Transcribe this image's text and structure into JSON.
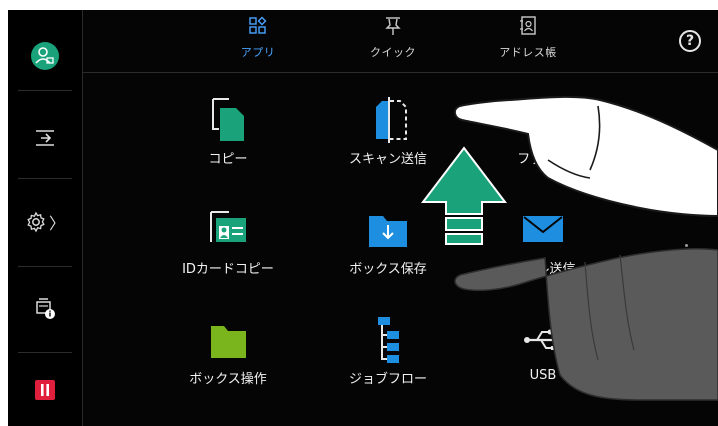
{
  "colors": {
    "accent": "#1aa37a",
    "screen_bg": "#050505",
    "pause_red": "#e01f3c",
    "tab_active": "#4aa3ff"
  },
  "sidebar": {
    "user_icon": "user-login-icon",
    "items": [
      {
        "icon": "job-in-icon"
      },
      {
        "icon": "settings-gear-icon",
        "chevron": "〉"
      },
      {
        "icon": "device-info-icon"
      },
      {
        "icon": "pause-icon"
      }
    ]
  },
  "tabs": [
    {
      "label": "アプリ",
      "icon": "apps-grid-icon",
      "active": true
    },
    {
      "label": "クイック",
      "icon": "quick-pin-icon",
      "active": false
    },
    {
      "label": "アドレス帳",
      "icon": "address-book-icon",
      "active": false
    }
  ],
  "help_icon": "?",
  "apps": [
    {
      "label": "コピー",
      "icon": "copy-icon"
    },
    {
      "label": "スキャン送信",
      "icon": "scan-send-icon"
    },
    {
      "label": "ファクス",
      "icon": "fax-icon"
    },
    {
      "label": "IDカードコピー",
      "icon": "id-card-copy-icon"
    },
    {
      "label": "ボックス保存",
      "icon": "box-save-icon"
    },
    {
      "label": "メール送信",
      "icon": "email-send-icon"
    },
    {
      "label": "ボックス操作",
      "icon": "box-operation-icon"
    },
    {
      "label": "ジョブフロー",
      "icon": "job-flow-icon"
    },
    {
      "label": "USB",
      "icon": "usb-icon"
    }
  ],
  "overlay": {
    "gesture": "swipe-up",
    "arrow_icon": "swipe-up-arrow-icon"
  }
}
